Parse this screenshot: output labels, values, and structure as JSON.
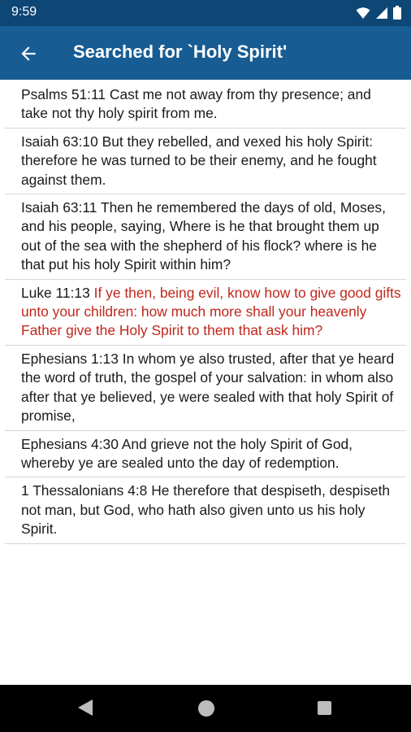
{
  "status_bar": {
    "time": "9:59",
    "icons": [
      "wifi-icon",
      "signal-icon",
      "battery-icon"
    ]
  },
  "app_bar": {
    "title": "Searched for `Holy Spirit'",
    "back_icon": "arrow-left-icon"
  },
  "colors": {
    "app_bar": "#175c93",
    "status_bar": "#0e4675",
    "words_of_jesus": "#c0271c",
    "text": "#1a1a1a"
  },
  "results": [
    {
      "ref": "Psalms 51:11",
      "text": "Cast me not away from thy presence; and take not thy holy spirit from me.",
      "red": false
    },
    {
      "ref": "Isaiah 63:10",
      "text": "But they rebelled, and vexed his holy Spirit: therefore he was turned to be their enemy, and he fought against them.",
      "red": false
    },
    {
      "ref": "Isaiah 63:11",
      "text": "Then he remembered the days of old, Moses, and his people, saying, Where is he that brought them up out of the sea with the shepherd of his flock? where is he that put his holy Spirit within him?",
      "red": false
    },
    {
      "ref": "Luke 11:13",
      "text": "If ye then, being evil, know how to give good gifts unto your children: how much more shall your heavenly Father give the Holy Spirit to them that ask him?",
      "red": true
    },
    {
      "ref": "Ephesians 1:13",
      "text": "In whom ye also trusted, after that ye heard the word of truth, the gospel of your salvation: in whom also after that ye believed, ye were sealed with that holy Spirit of promise,",
      "red": false
    },
    {
      "ref": "Ephesians 4:30",
      "text": "And grieve not the holy Spirit of God, whereby ye are sealed unto the day of redemption.",
      "red": false
    },
    {
      "ref": "1 Thessalonians 4:8",
      "text": "He therefore that despiseth, despiseth not man, but God, who hath also given unto us his holy Spirit.",
      "red": false
    }
  ],
  "nav_bar": {
    "buttons": [
      "back-triangle-icon",
      "home-circle-icon",
      "recents-square-icon"
    ]
  }
}
